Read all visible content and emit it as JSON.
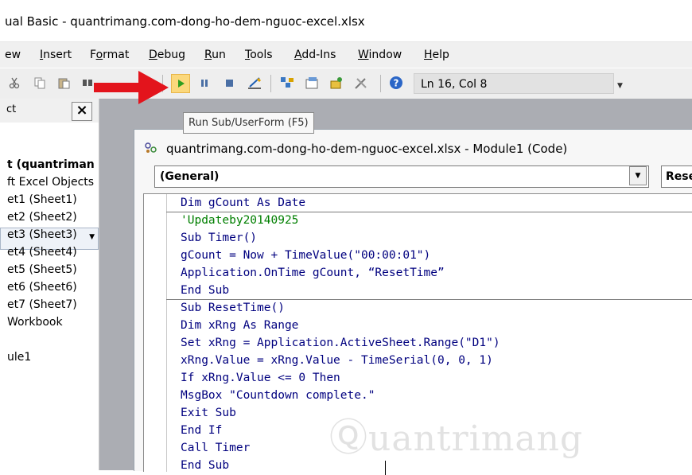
{
  "window": {
    "title": "ual Basic - quantrimang.com-dong-ho-dem-nguoc-excel.xlsx"
  },
  "menu": [
    {
      "label": "ew",
      "accel": ""
    },
    {
      "label": "Insert",
      "accel": "I"
    },
    {
      "label": "Format",
      "accel": "o"
    },
    {
      "label": "Debug",
      "accel": "D"
    },
    {
      "label": "Run",
      "accel": "R"
    },
    {
      "label": "Tools",
      "accel": "T"
    },
    {
      "label": "Add-Ins",
      "accel": "A"
    },
    {
      "label": "Window",
      "accel": "W"
    },
    {
      "label": "Help",
      "accel": "H"
    }
  ],
  "toolbar": {
    "icons": [
      "cut-icon",
      "copy-icon",
      "paste-icon",
      "find-icon",
      "run-sub-icon",
      "break-icon",
      "reset-icon",
      "design-mode-icon",
      "project-explorer-icon",
      "properties-icon",
      "object-browser-icon",
      "toolbox-icon",
      "help-icon"
    ],
    "position": "Ln 16, Col 8",
    "run_tooltip": "Run Sub/UserForm (F5)",
    "accent": "#fbd87c"
  },
  "project": {
    "header": "ct",
    "close": "×",
    "tree": [
      {
        "text": "t (quantriman",
        "bold": true
      },
      {
        "text": "ft Excel Objects",
        "bold": false
      },
      {
        "text": "et1 (Sheet1)",
        "bold": false
      },
      {
        "text": "et2 (Sheet2)",
        "bold": false
      },
      {
        "text": "et3 (Sheet3)",
        "bold": false
      },
      {
        "text": "et4 (Sheet4)",
        "bold": false
      },
      {
        "text": "et5 (Sheet5)",
        "bold": false
      },
      {
        "text": "et6 (Sheet6)",
        "bold": false
      },
      {
        "text": "et7 (Sheet7)",
        "bold": false
      },
      {
        "text": "Workbook",
        "bold": false
      },
      {
        "text": "ule1",
        "bold": false
      }
    ]
  },
  "code_window": {
    "title": "quantrimang.com-dong-ho-dem-nguoc-excel.xlsx - Module1 (Code)",
    "object_combo": "(General)",
    "proc_combo": "Rese",
    "lines": [
      {
        "text": "Dim gCount As Date",
        "type": "code"
      },
      {
        "text": "'Updateby20140925",
        "type": "comment"
      },
      {
        "text": "Sub Timer()",
        "type": "code"
      },
      {
        "text": "gCount = Now + TimeValue(\"00:00:01\")",
        "type": "code"
      },
      {
        "text": "Application.OnTime gCount, “ResetTime”",
        "type": "code"
      },
      {
        "text": "End Sub",
        "type": "code"
      },
      {
        "text": "Sub ResetTime()",
        "type": "code"
      },
      {
        "text": "Dim xRng As Range",
        "type": "code"
      },
      {
        "text": "Set xRng = Application.ActiveSheet.Range(\"D1\")",
        "type": "code"
      },
      {
        "text": "xRng.Value = xRng.Value - TimeSerial(0, 0, 1)",
        "type": "code"
      },
      {
        "text": "If xRng.Value <= 0 Then",
        "type": "code"
      },
      {
        "text": "MsgBox \"Countdown complete.\"",
        "type": "code"
      },
      {
        "text": "Exit Sub",
        "type": "code"
      },
      {
        "text": "End If",
        "type": "code"
      },
      {
        "text": "Call Timer",
        "type": "code"
      },
      {
        "text": "End Sub",
        "type": "code"
      }
    ]
  },
  "watermark": "Quantrimang",
  "colors": {
    "keyword": "#00007f",
    "comment": "#007f00",
    "arrow": "#e3141c",
    "mdi": "#abadb3"
  }
}
